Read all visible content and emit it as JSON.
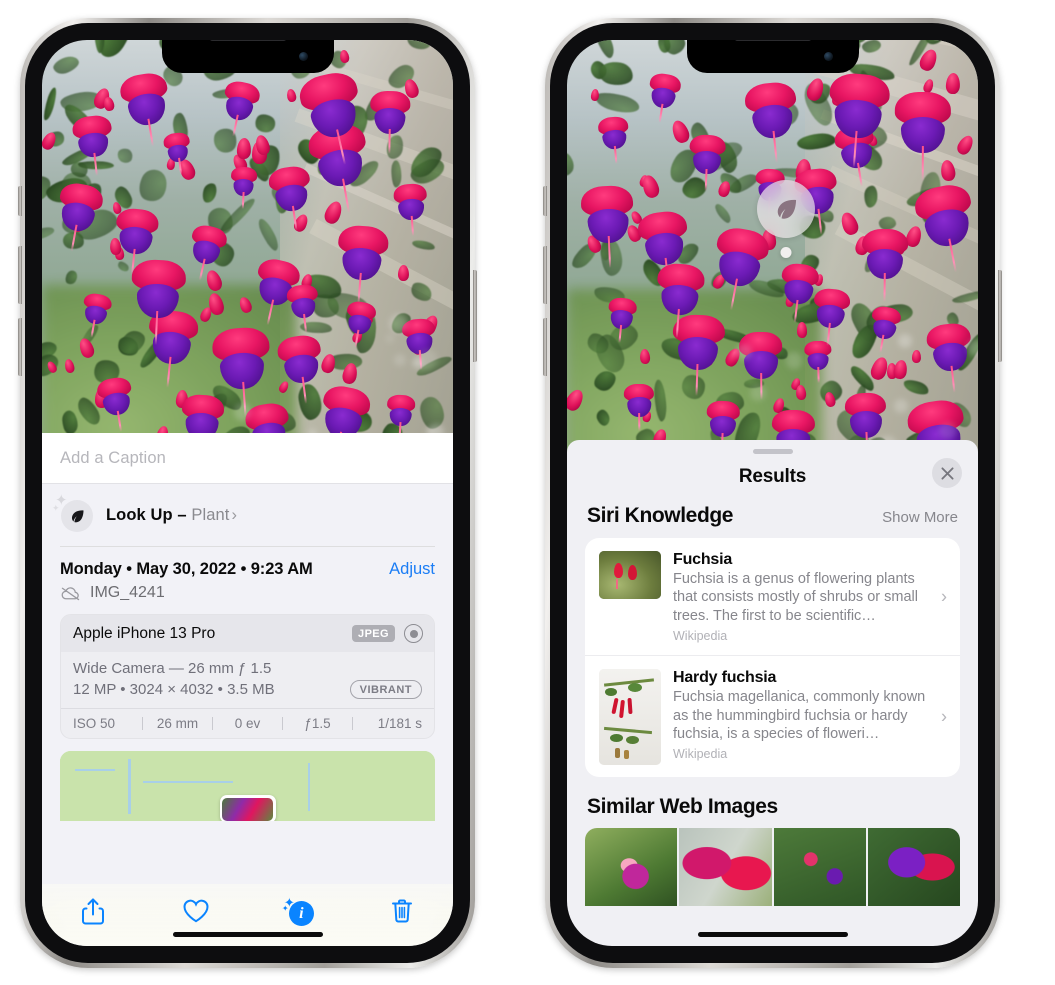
{
  "left_phone": {
    "caption_placeholder": "Add a Caption",
    "lookup": {
      "icon": "leaf-icon",
      "label": "Look Up – ",
      "subject": "Plant",
      "chevron": "›"
    },
    "meta": {
      "date": "Monday • May 30, 2022 • 9:23 AM",
      "adjust_label": "Adjust",
      "cloud_icon": "cloud-slash-icon",
      "filename": "IMG_4241"
    },
    "camera": {
      "model": "Apple iPhone 13 Pro",
      "format_chip": "JPEG",
      "lens_icon": "lens-icon",
      "lens_line": "Wide Camera — 26 mm ƒ 1.5",
      "spec_line": "12 MP • 3024 × 4032 • 3.5 MB",
      "style_chip": "VIBRANT",
      "exif": [
        "ISO 50",
        "26 mm",
        "0 ev",
        "ƒ1.5",
        "1/181 s"
      ]
    },
    "toolbar": [
      {
        "name": "share-button",
        "icon": "share-icon"
      },
      {
        "name": "favorite-button",
        "icon": "heart-icon"
      },
      {
        "name": "info-button",
        "icon": "sparkle-info-icon",
        "glyph": "i"
      },
      {
        "name": "delete-button",
        "icon": "trash-icon"
      }
    ]
  },
  "right_phone": {
    "leaf_badge_icon": "leaf-icon",
    "sheet": {
      "title": "Results",
      "close_icon": "close-icon",
      "sections": [
        {
          "title": "Siri Knowledge",
          "action": "Show More",
          "items": [
            {
              "name": "Fuchsia",
              "description": "Fuchsia is a genus of flowering plants that consists mostly of shrubs or small trees. The first to be scientific…",
              "source": "Wikipedia",
              "chevron": "›"
            },
            {
              "name": "Hardy fuchsia",
              "description": "Fuchsia magellanica, commonly known as the hummingbird fuchsia or hardy fuchsia, is a species of floweri…",
              "source": "Wikipedia",
              "chevron": "›"
            }
          ]
        },
        {
          "title": "Similar Web Images",
          "thumbnails": [
            "web-image-1",
            "web-image-2",
            "web-image-3",
            "web-image-4"
          ]
        }
      ]
    }
  },
  "colors": {
    "accent_blue": "#0a84ff",
    "link_blue": "#1b7df5",
    "sheet_bg": "#f0f0f4",
    "card_white": "#ffffff",
    "secondary_text": "#86868c"
  }
}
